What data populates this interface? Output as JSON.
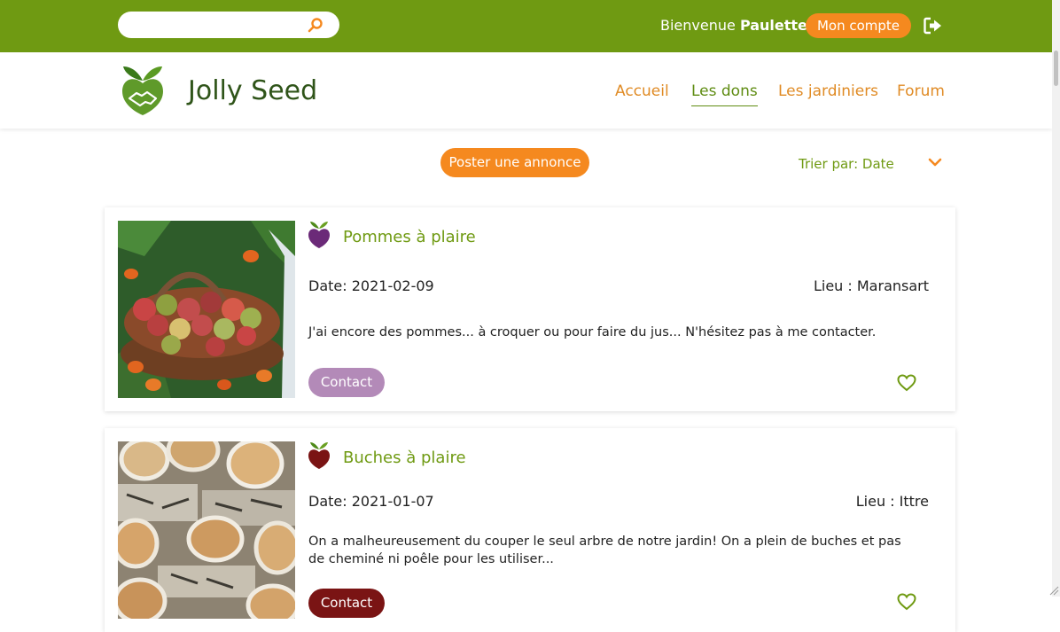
{
  "topbar": {
    "search_placeholder": "",
    "welcome_prefix": "Bienvenue",
    "user_name": "Paulette",
    "account_label": "Mon compte"
  },
  "header": {
    "brand": "Jolly Seed",
    "nav": [
      {
        "label": "Accueil",
        "active": false
      },
      {
        "label": "Les dons",
        "active": true
      },
      {
        "label": "Les jardiniers",
        "active": false
      },
      {
        "label": "Forum",
        "active": false
      }
    ]
  },
  "toolbar": {
    "post_label": "Poster une annonce",
    "sort_label": "Trier par: Date"
  },
  "listings": [
    {
      "title": "Pommes à plaire",
      "date": "Date: 2021-02-09",
      "place": "Lieu : Maransart",
      "description": "J'ai encore des pommes... à croquer ou pour faire du jus... N'hésitez pas à me contacter.",
      "contact_label": "Contact",
      "contact_color": "#b38ab8",
      "icon_color": "#6b2a78"
    },
    {
      "title": "Buches à plaire",
      "date": "Date: 2021-01-07",
      "place": "Lieu : Ittre",
      "description": "On a malheureusement du couper le seul arbre de notre jardin! On a plein de buches et pas de cheminé ni poêle pour les utiliser...",
      "contact_label": "Contact",
      "contact_color": "#7a1414",
      "icon_color": "#7a1414"
    }
  ],
  "colors": {
    "primary_green": "#6f9a12",
    "accent_orange": "#f5891f",
    "brand_dark_green": "#2f5419"
  }
}
